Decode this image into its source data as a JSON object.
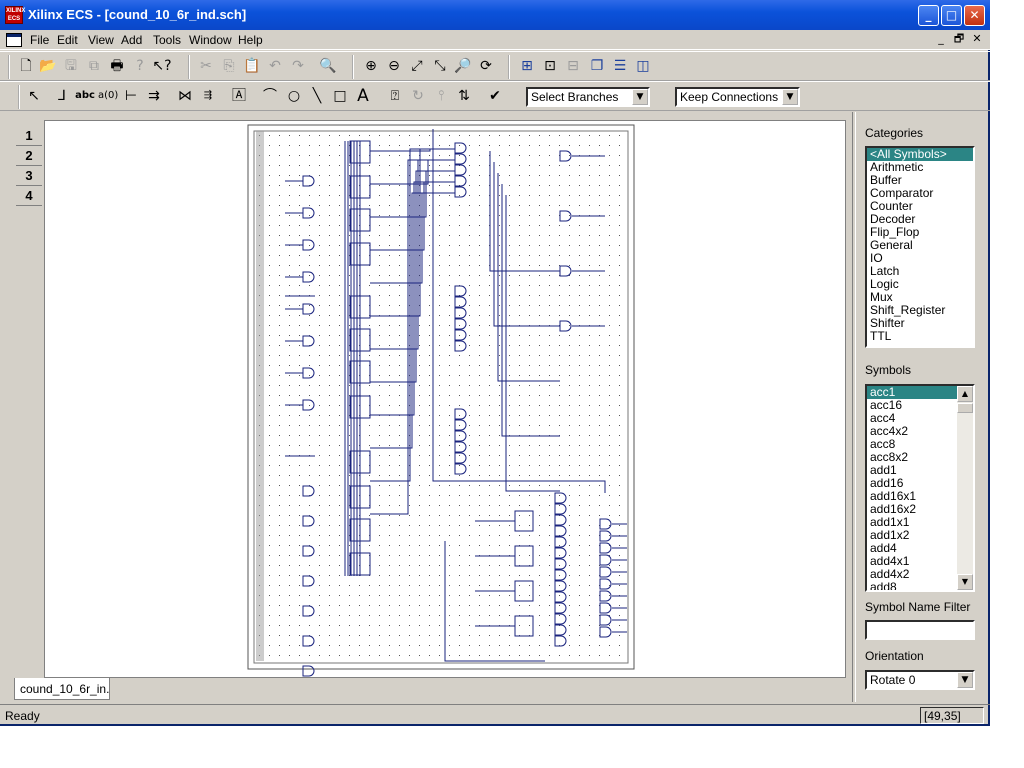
{
  "window": {
    "app_icon_text": "XILINX ECS",
    "title": "Xilinx ECS - [cound_10_6r_ind.sch]",
    "minimize": "_",
    "maximize": "□",
    "close": "✕"
  },
  "menu": {
    "items": [
      "File",
      "Edit",
      "View",
      "Add",
      "Tools",
      "Window",
      "Help"
    ],
    "mdi_controls": [
      "_",
      "🗗",
      "✕"
    ]
  },
  "toolbar1": {
    "icons": [
      "new-file",
      "open-folder",
      "save",
      "save-all",
      "print",
      "help",
      "context-help",
      "cut",
      "copy",
      "paste",
      "undo",
      "redo",
      "find",
      "zoom-in",
      "zoom-out",
      "zoom-full",
      "zoom-to-box",
      "zoom-selected",
      "refresh",
      "hierarchy-push",
      "hierarchy-pop",
      "hierarchy-up",
      "cascade",
      "tile-horizontal",
      "tile-vertical"
    ]
  },
  "toolbar2": {
    "icons": [
      "select-arrow",
      "add-wire",
      "add-net-name",
      "rename-bus",
      "add-bus-tap",
      "add-io-marker",
      "add-symbol",
      "add-instance-name",
      "add-attribute-text",
      "draw-arc",
      "draw-circle",
      "draw-line",
      "draw-rectangle",
      "add-text",
      "query",
      "rotate",
      "mirror",
      "flip",
      "check-schematic"
    ],
    "branch_combo": "Select Branches",
    "connection_combo": "Keep Connections"
  },
  "sheet_tabs": [
    "1",
    "2",
    "3",
    "4"
  ],
  "document_tab": "cound_10_6r_in...",
  "side_panel": {
    "categories_label": "Categories",
    "categories": [
      "<All Symbols>",
      "Arithmetic",
      "Buffer",
      "Comparator",
      "Counter",
      "Decoder",
      "Flip_Flop",
      "General",
      "IO",
      "Latch",
      "Logic",
      "Mux",
      "Shift_Register",
      "Shifter",
      "TTL"
    ],
    "selected_category": "<All Symbols>",
    "symbols_label": "Symbols",
    "symbols": [
      "acc1",
      "acc16",
      "acc4",
      "acc4x2",
      "acc8",
      "acc8x2",
      "add1",
      "add16",
      "add16x1",
      "add16x2",
      "add1x1",
      "add1x2",
      "add4",
      "add4x1",
      "add4x2",
      "add8"
    ],
    "selected_symbol": "acc1",
    "name_filter_label": "Symbol Name Filter",
    "name_filter_value": "",
    "orientation_label": "Orientation",
    "orientation_value": "Rotate 0"
  },
  "status": {
    "text": "Ready",
    "coords": "[49,35]"
  }
}
